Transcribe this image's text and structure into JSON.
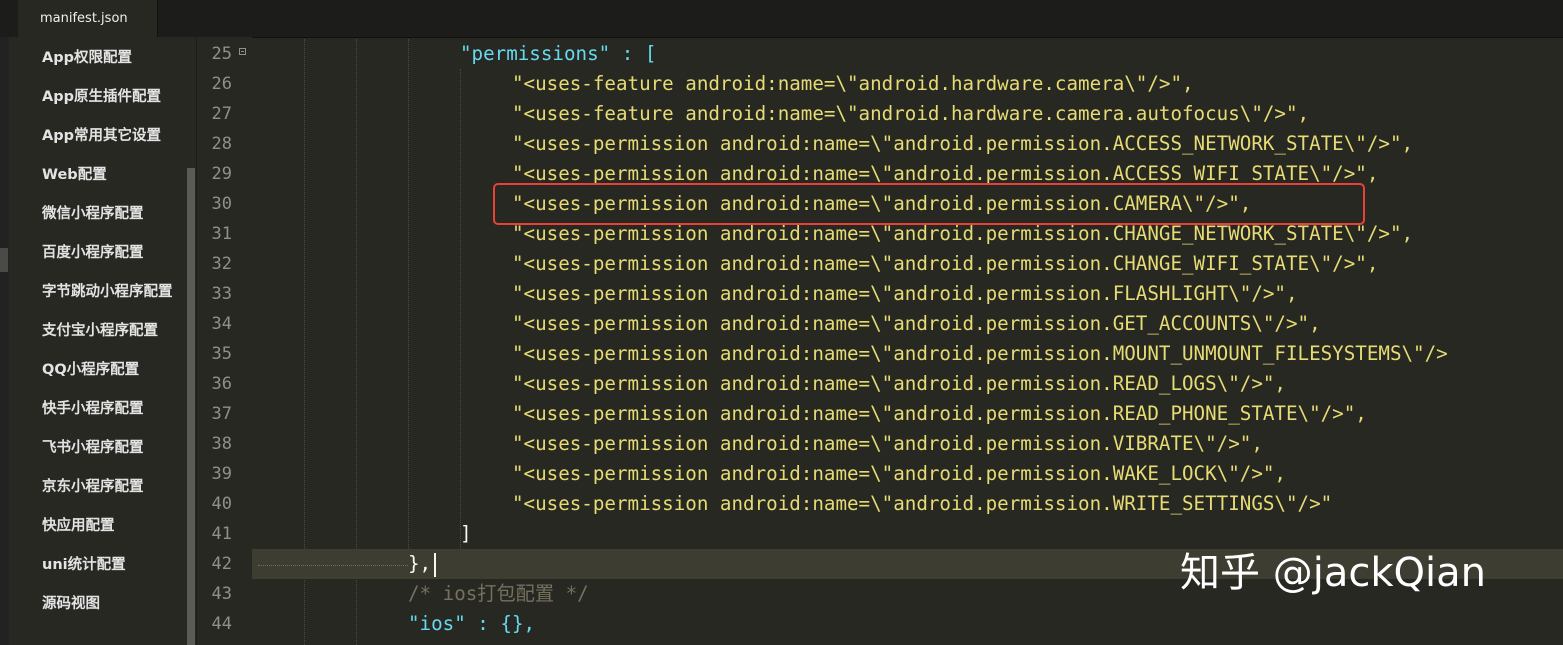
{
  "tab": {
    "title": "manifest.json"
  },
  "sidebar": {
    "items": [
      "App权限配置",
      "App原生插件配置",
      "App常用其它设置",
      "Web配置",
      "微信小程序配置",
      "百度小程序配置",
      "字节跳动小程序配置",
      "支付宝小程序配置",
      "QQ小程序配置",
      "快手小程序配置",
      "飞书小程序配置",
      "京东小程序配置",
      "快应用配置",
      "uni统计配置",
      "源码视图"
    ]
  },
  "editor": {
    "line_numbers": [
      "25",
      "26",
      "27",
      "28",
      "29",
      "30",
      "31",
      "32",
      "33",
      "34",
      "35",
      "36",
      "37",
      "38",
      "39",
      "40",
      "41",
      "42",
      "43",
      "44"
    ],
    "active_line": "42",
    "highlighted_line": "30",
    "lines": [
      {
        "text": "\"permissions\" : ["
      },
      {
        "text": "\"<uses-feature android:name=\\\"android.hardware.camera\\\"/>\","
      },
      {
        "text": "\"<uses-feature android:name=\\\"android.hardware.camera.autofocus\\\"/>\","
      },
      {
        "text": "\"<uses-permission android:name=\\\"android.permission.ACCESS_NETWORK_STATE\\\"/>\","
      },
      {
        "text": "\"<uses-permission android:name=\\\"android.permission.ACCESS_WIFI_STATE\\\"/>\","
      },
      {
        "text": "\"<uses-permission android:name=\\\"android.permission.CAMERA\\\"/>\","
      },
      {
        "text": "\"<uses-permission android:name=\\\"android.permission.CHANGE_NETWORK_STATE\\\"/>\","
      },
      {
        "text": "\"<uses-permission android:name=\\\"android.permission.CHANGE_WIFI_STATE\\\"/>\","
      },
      {
        "text": "\"<uses-permission android:name=\\\"android.permission.FLASHLIGHT\\\"/>\","
      },
      {
        "text": "\"<uses-permission android:name=\\\"android.permission.GET_ACCOUNTS\\\"/>\","
      },
      {
        "text": "\"<uses-permission android:name=\\\"android.permission.MOUNT_UNMOUNT_FILESYSTEMS\\\"/>"
      },
      {
        "text": "\"<uses-permission android:name=\\\"android.permission.READ_LOGS\\\"/>\","
      },
      {
        "text": "\"<uses-permission android:name=\\\"android.permission.READ_PHONE_STATE\\\"/>\","
      },
      {
        "text": "\"<uses-permission android:name=\\\"android.permission.VIBRATE\\\"/>\","
      },
      {
        "text": "\"<uses-permission android:name=\\\"android.permission.WAKE_LOCK\\\"/>\","
      },
      {
        "text": "\"<uses-permission android:name=\\\"android.permission.WRITE_SETTINGS\\\"/>\""
      },
      {
        "text": "]"
      },
      {
        "text": "},"
      },
      {
        "text": "/* ios打包配置 */"
      },
      {
        "text": "\"ios\" : {},"
      }
    ]
  },
  "watermark": {
    "text": "知乎 @jackQian"
  },
  "colors": {
    "background": "#272822",
    "string": "#e6db74",
    "key": "#66d9ef",
    "comment": "#75715e",
    "highlight_box": "#e8413a"
  }
}
